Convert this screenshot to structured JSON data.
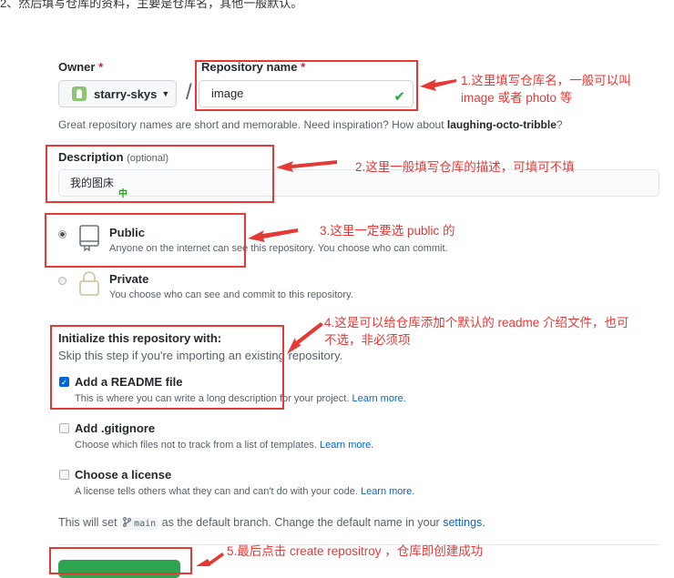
{
  "top_note": "2、然后填写仓库的资料，主要是仓库名，其他一般默认。",
  "owner": {
    "label": "Owner",
    "required": "*",
    "value": "starry-skys"
  },
  "repo": {
    "label": "Repository name",
    "required": "*",
    "value": "image",
    "separator": "/"
  },
  "hint": {
    "prefix": "Great repository names are short and memorable. Need inspiration? How about ",
    "suggestion": "laughing-octo-tribble",
    "suffix": "?"
  },
  "description": {
    "label": "Description",
    "optional": "(optional)",
    "value": "我的图床",
    "ime_indicator": "中"
  },
  "visibility": {
    "public": {
      "title": "Public",
      "sub": "Anyone on the internet can see this repository. You choose who can commit."
    },
    "private": {
      "title": "Private",
      "sub": "You choose who can see and commit to this repository."
    }
  },
  "initialize": {
    "title": "Initialize this repository with:",
    "sub": "Skip this step if you're importing an existing repository.",
    "readme": {
      "title": "Add a README file",
      "sub": "This is where you can write a long description for your project.",
      "link": "Learn more."
    },
    "gitignore": {
      "title": "Add .gitignore",
      "sub": "Choose which files not to track from a list of templates.",
      "link": "Learn more."
    },
    "license": {
      "title": "Choose a license",
      "sub": "A license tells others what they can and can't do with your code.",
      "link": "Learn more."
    }
  },
  "branch": {
    "prefix": "This will set ",
    "name": "main",
    "middle": " as the default branch. Change the default name in your ",
    "link": "settings",
    "suffix": "."
  },
  "annotations": {
    "a1_line1": "1.这里填写仓库名，一般可以叫",
    "a1_line2": "image 或者 photo 等",
    "a2": "2.这里一般填写仓库的描述，可填可不填",
    "a3": "3.这里一定要选 public 的",
    "a4_line1": "4.这是可以给仓库添加个默认的 readme 介绍文件，也可",
    "a4_line2": "不选，非必须项",
    "a5": "5.最后点击 create repositroy ，仓库即创建成功"
  },
  "colors": {
    "annotation": "#e53935",
    "link": "#0366d6",
    "success": "#2ea44f"
  }
}
